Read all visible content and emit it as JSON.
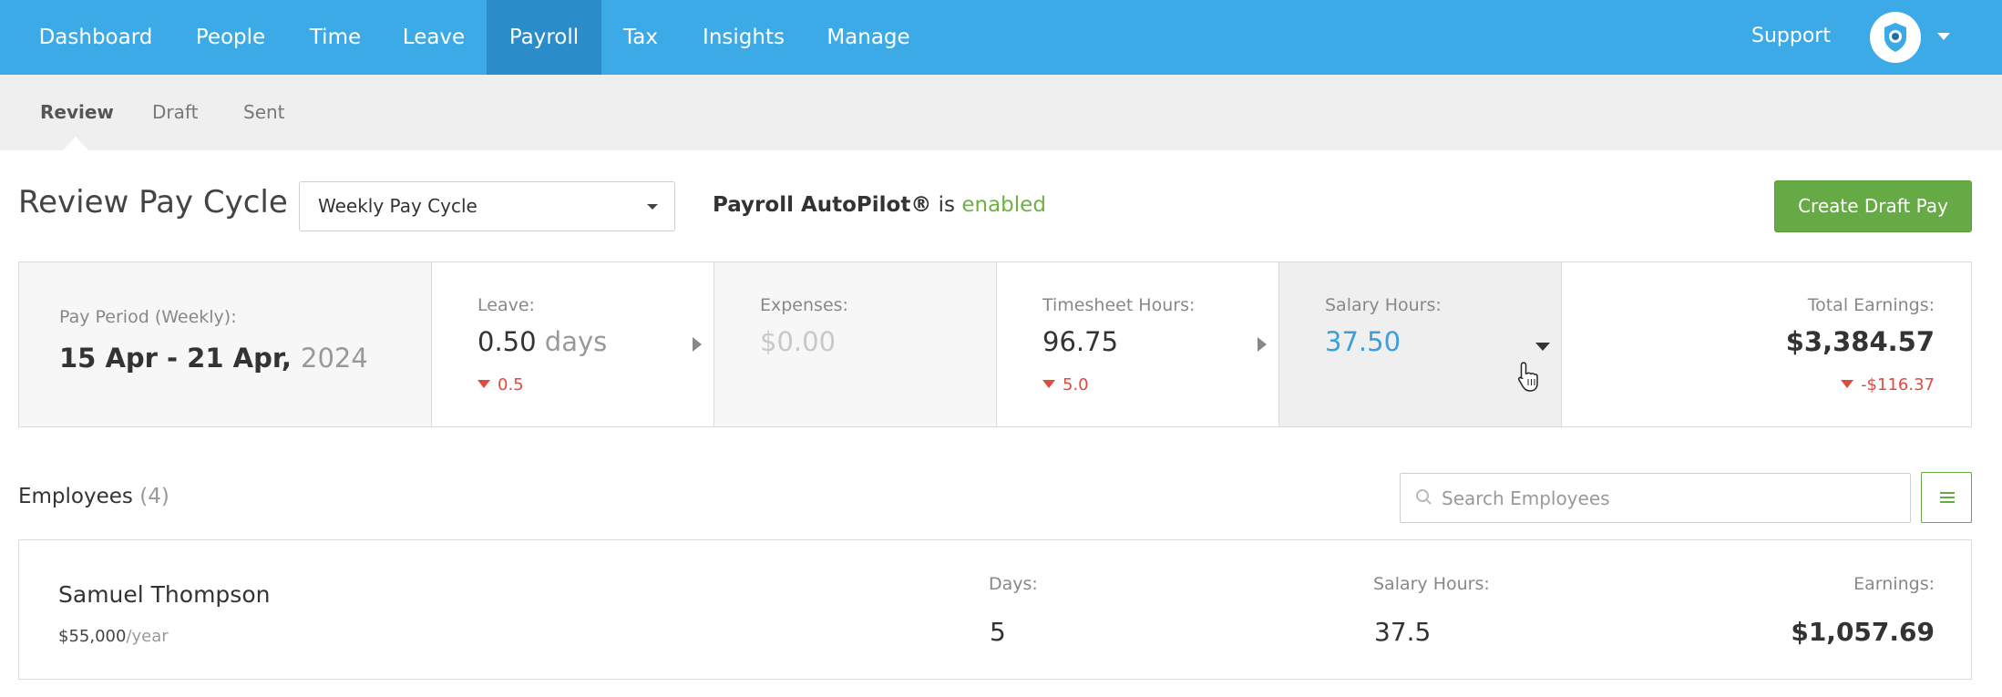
{
  "topnav": {
    "items": [
      {
        "label": "Dashboard"
      },
      {
        "label": "People"
      },
      {
        "label": "Time"
      },
      {
        "label": "Leave"
      },
      {
        "label": "Payroll",
        "active": true
      },
      {
        "label": "Tax"
      },
      {
        "label": "Insights"
      },
      {
        "label": "Manage"
      }
    ],
    "support_label": "Support",
    "avatar_icon": "shield-heart-icon"
  },
  "subnav": {
    "items": [
      {
        "label": "Review",
        "active": true
      },
      {
        "label": "Draft"
      },
      {
        "label": "Sent"
      }
    ]
  },
  "header": {
    "title": "Review Pay Cycle",
    "pay_cycle_select": "Weekly Pay Cycle",
    "autopilot_name": "Payroll AutoPilot®",
    "autopilot_is": "is",
    "autopilot_status": "enabled",
    "create_button": "Create Draft Pay"
  },
  "summary": {
    "pay_period": {
      "label": "Pay Period (Weekly):",
      "range": "15 Apr - 21 Apr,",
      "year": "2024"
    },
    "leave": {
      "label": "Leave:",
      "value": "0.50",
      "unit": "days",
      "delta": "0.5"
    },
    "expenses": {
      "label": "Expenses:",
      "value": "$0.00"
    },
    "timesheet": {
      "label": "Timesheet Hours:",
      "value": "96.75",
      "delta": "5.0"
    },
    "salary": {
      "label": "Salary Hours:",
      "value": "37.50"
    },
    "total": {
      "label": "Total Earnings:",
      "value": "$3,384.57",
      "delta": "-$116.37"
    }
  },
  "employees": {
    "title": "Employees",
    "count": "(4)",
    "search_placeholder": "Search Employees",
    "rows": [
      {
        "name": "Samuel Thompson",
        "salary": "$55,000",
        "salary_period": "/year",
        "days_label": "Days:",
        "days": "5",
        "hours_label": "Salary Hours:",
        "hours": "37.5",
        "earnings_label": "Earnings:",
        "earnings": "$1,057.69"
      }
    ]
  },
  "colors": {
    "nav_blue": "#3daae8",
    "nav_active": "#2a8cc8",
    "green": "#65aa45",
    "red": "#e04a3f",
    "link_blue": "#3a9fe0"
  }
}
